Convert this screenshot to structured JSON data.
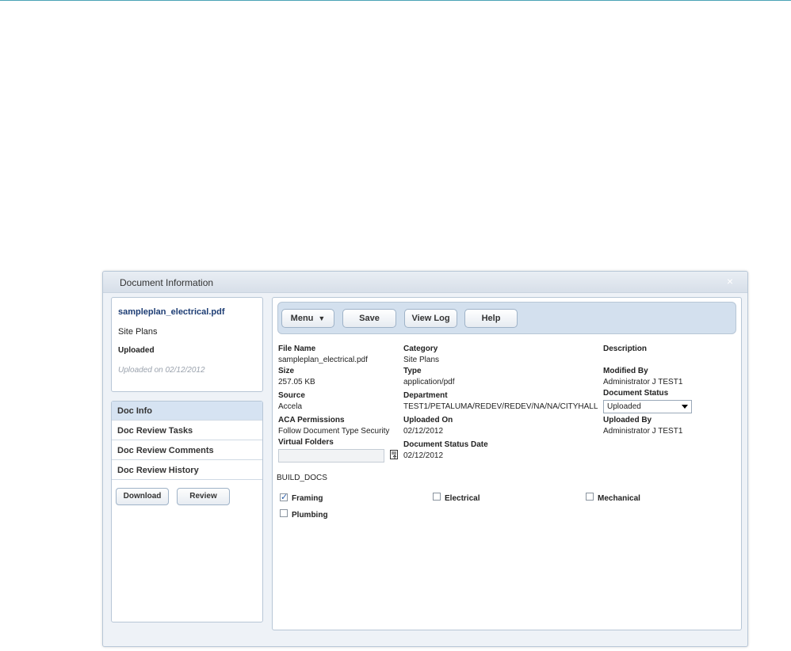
{
  "dialog": {
    "title": "Document Information",
    "close_glyph": "×"
  },
  "summary": {
    "file_name": "sampleplan_electrical.pdf",
    "category": "Site Plans",
    "status": "Uploaded",
    "uploaded_on": "Uploaded on 02/12/2012"
  },
  "nav": {
    "items": [
      "Doc Info",
      "Doc Review Tasks",
      "Doc Review Comments",
      "Doc Review History"
    ],
    "active": "Doc Info",
    "download_label": "Download",
    "review_label": "Review"
  },
  "toolbar": {
    "menu_label": "Menu",
    "save_label": "Save",
    "view_log_label": "View Log",
    "help_label": "Help"
  },
  "fields": {
    "file_name": {
      "label": "File Name",
      "value": "sampleplan_electrical.pdf"
    },
    "category": {
      "label": "Category",
      "value": "Site Plans"
    },
    "description": {
      "label": "Description",
      "value": ""
    },
    "size": {
      "label": "Size",
      "value": "257.05 KB"
    },
    "type": {
      "label": "Type",
      "value": "application/pdf"
    },
    "modified_by": {
      "label": "Modified By",
      "value": "Administrator J TEST1"
    },
    "source": {
      "label": "Source",
      "value": "Accela"
    },
    "department": {
      "label": "Department",
      "value": "TEST1/PETALUMA/REDEV/REDEV/NA/NA/CITYHALL"
    },
    "document_status": {
      "label": "Document Status",
      "value": "Uploaded"
    },
    "aca_permissions": {
      "label": "ACA Permissions",
      "value": "Follow Document Type Security"
    },
    "uploaded_on": {
      "label": "Uploaded On",
      "value": "02/12/2012"
    },
    "uploaded_by": {
      "label": "Uploaded By",
      "value": "Administrator J TEST1"
    },
    "virtual_folders": {
      "label": "Virtual Folders",
      "value": ""
    },
    "document_status_date": {
      "label": "Document Status Date",
      "value": "02/12/2012"
    }
  },
  "build_docs": {
    "heading": "BUILD_DOCS",
    "options": [
      {
        "label": "Framing",
        "checked": true
      },
      {
        "label": "Electrical",
        "checked": false
      },
      {
        "label": "Mechanical",
        "checked": false
      },
      {
        "label": "Plumbing",
        "checked": false
      }
    ]
  },
  "colors": {
    "accent": "#1d3d74",
    "toolbar_bg": "#d3e0ee",
    "active_nav": "#d6e3f2",
    "border": "#b7c6d6"
  }
}
